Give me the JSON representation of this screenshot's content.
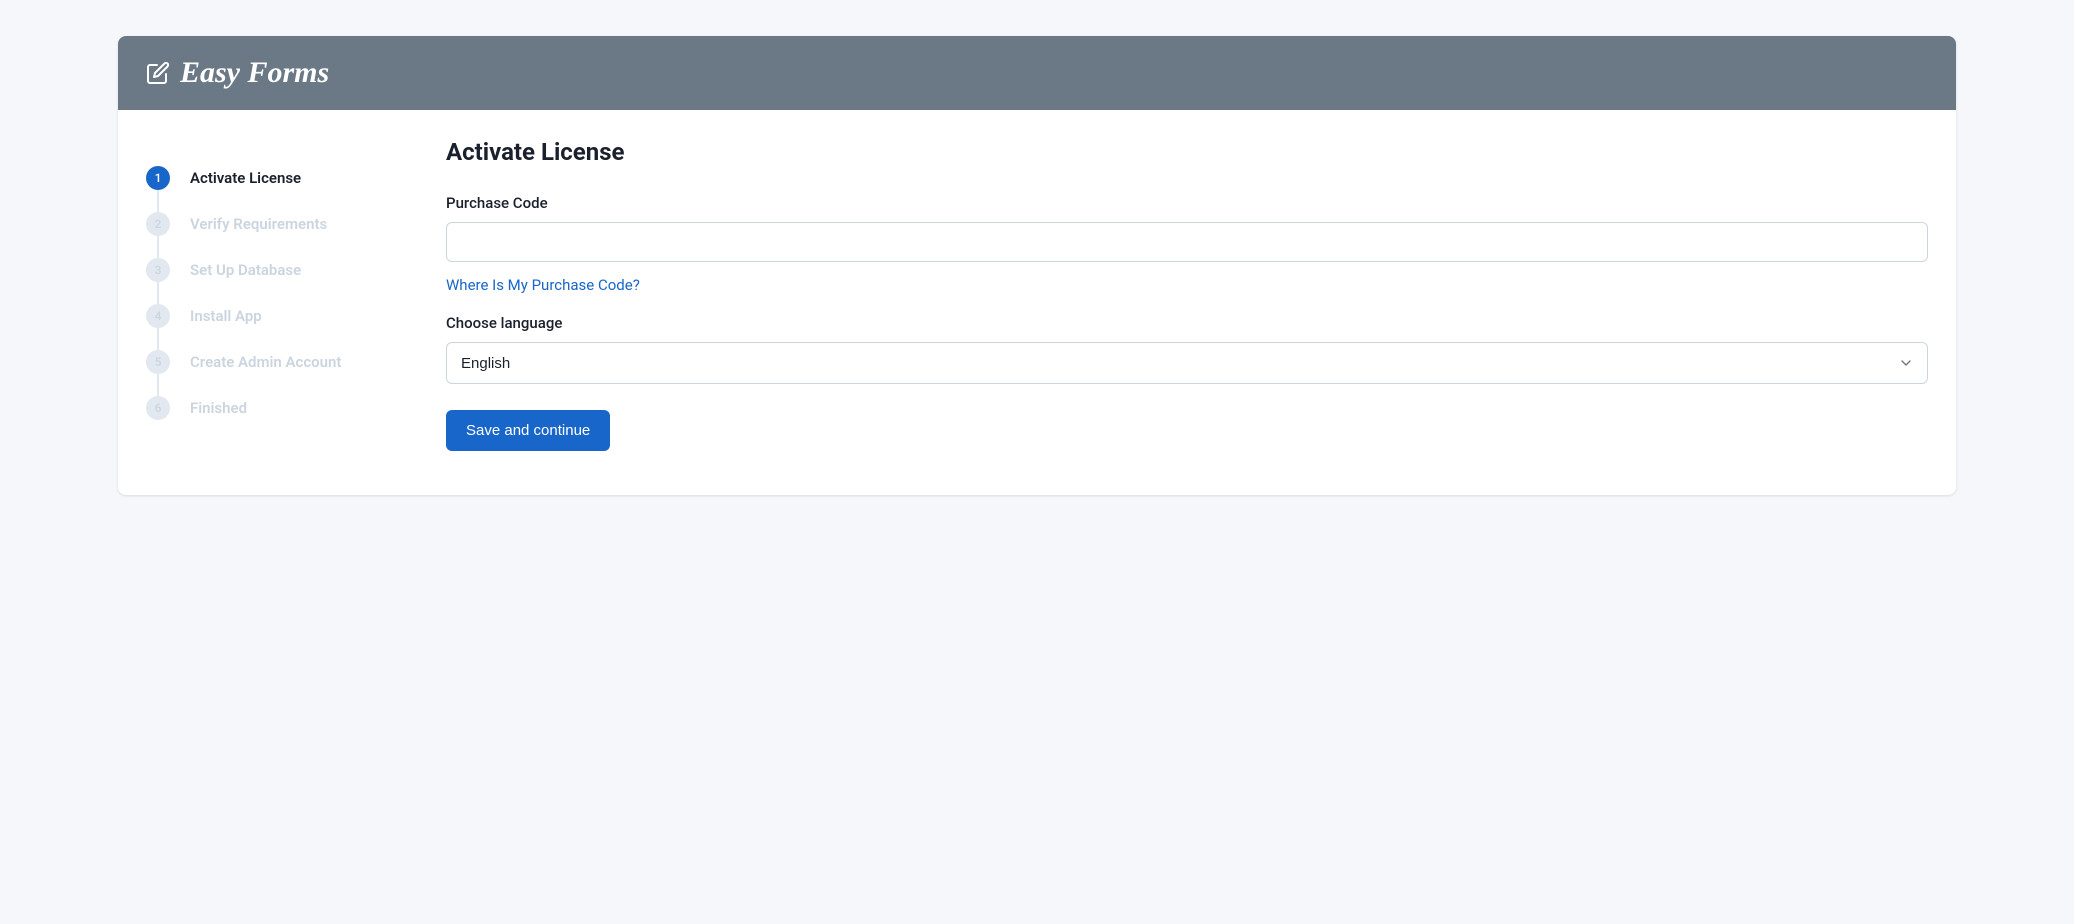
{
  "brand": {
    "name": "Easy Forms"
  },
  "sidebar": {
    "steps": [
      {
        "num": "1",
        "label": "Activate License",
        "active": true
      },
      {
        "num": "2",
        "label": "Verify Requirements",
        "active": false
      },
      {
        "num": "3",
        "label": "Set Up Database",
        "active": false
      },
      {
        "num": "4",
        "label": "Install App",
        "active": false
      },
      {
        "num": "5",
        "label": "Create Admin Account",
        "active": false
      },
      {
        "num": "6",
        "label": "Finished",
        "active": false
      }
    ]
  },
  "main": {
    "title": "Activate License",
    "purchase_code": {
      "label": "Purchase Code",
      "value": "",
      "help_link": "Where Is My Purchase Code?"
    },
    "language": {
      "label": "Choose language",
      "selected": "English"
    },
    "submit_label": "Save and continue"
  }
}
